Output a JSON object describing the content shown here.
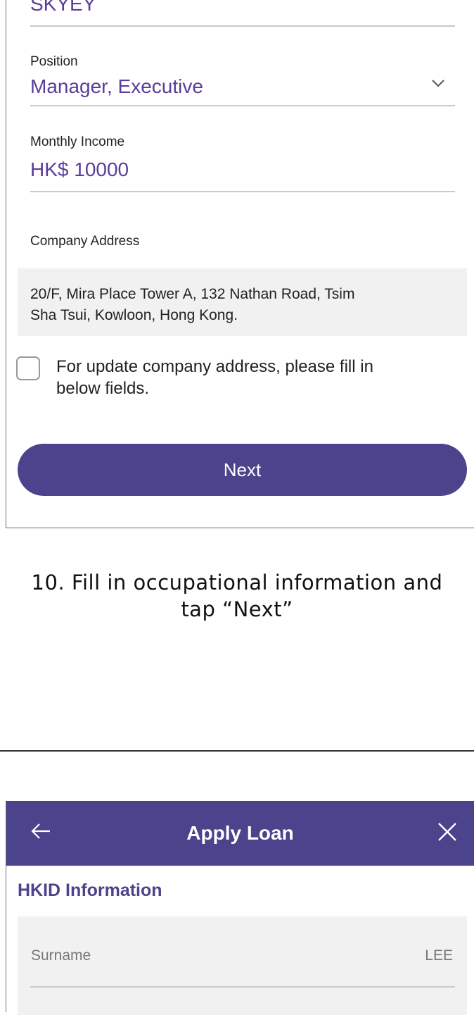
{
  "form": {
    "company_name_value": "SKYEY",
    "position_label": "Position",
    "position_value": "Manager, Executive",
    "monthly_income_label": "Monthly Income",
    "monthly_income_value": "HK$ 10000",
    "company_address_label": "Company Address",
    "company_address_line1": "20/F, Mira Place Tower A, 132 Nathan Road, Tsim",
    "company_address_line2": "Sha Tsui, Kowloon, Hong Kong.",
    "update_address_line1": "For update company address, please fill in",
    "update_address_line2": "below fields.",
    "update_address_checked": false,
    "next_label": "Next"
  },
  "caption": {
    "line1": "10. Fill in occupational information and",
    "line2": "tap “Next”"
  },
  "next_screen": {
    "title": "Apply Loan",
    "section_heading": "HKID Information",
    "surname_label": "Surname",
    "surname_value": "LEE"
  },
  "colors": {
    "brand": "#4b438b",
    "value_text": "#5a3d9a",
    "field_bg": "#f1f1f1"
  },
  "icons": [
    "chevron-down-icon",
    "back-arrow-icon",
    "close-icon"
  ]
}
